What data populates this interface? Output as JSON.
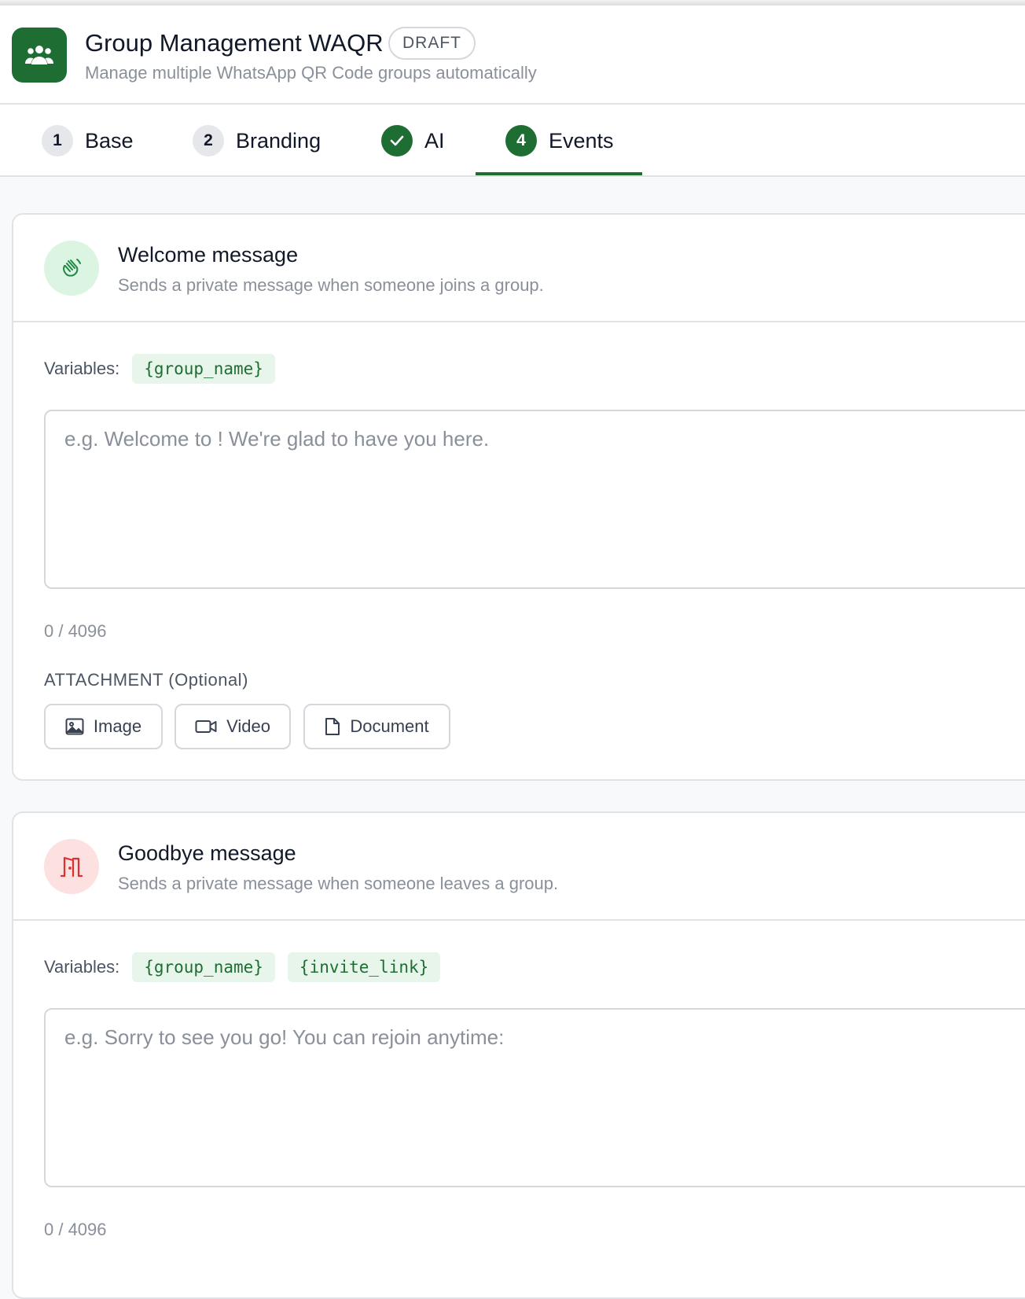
{
  "header": {
    "title": "Group Management WAQR",
    "badge": "DRAFT",
    "subtitle": "Manage multiple WhatsApp QR Code groups automatically",
    "icon": "users-icon",
    "accent_color": "#1e6e33"
  },
  "tabs": [
    {
      "number": "1",
      "label": "Base",
      "state": "pending"
    },
    {
      "number": "2",
      "label": "Branding",
      "state": "pending"
    },
    {
      "number": "",
      "label": "AI",
      "state": "done"
    },
    {
      "number": "4",
      "label": "Events",
      "state": "active"
    }
  ],
  "welcome": {
    "title": "Welcome message",
    "description": "Sends a private message when someone joins a group.",
    "icon": "waving-hand-icon",
    "variables_label": "Variables:",
    "variables": [
      "{group_name}"
    ],
    "placeholder": "e.g. Welcome to ! We're glad to have you here.",
    "count": "0 / 4096",
    "attachment_label": "ATTACHMENT",
    "attachment_optional": "(Optional)",
    "buttons": {
      "image": "Image",
      "video": "Video",
      "document": "Document"
    }
  },
  "goodbye": {
    "title": "Goodbye message",
    "description": "Sends a private message when someone leaves a group.",
    "icon": "door-exit-icon",
    "variables_label": "Variables:",
    "variables": [
      "{group_name}",
      "{invite_link}"
    ],
    "placeholder": "e.g. Sorry to see you go! You can rejoin anytime:",
    "count": "0 / 4096"
  }
}
